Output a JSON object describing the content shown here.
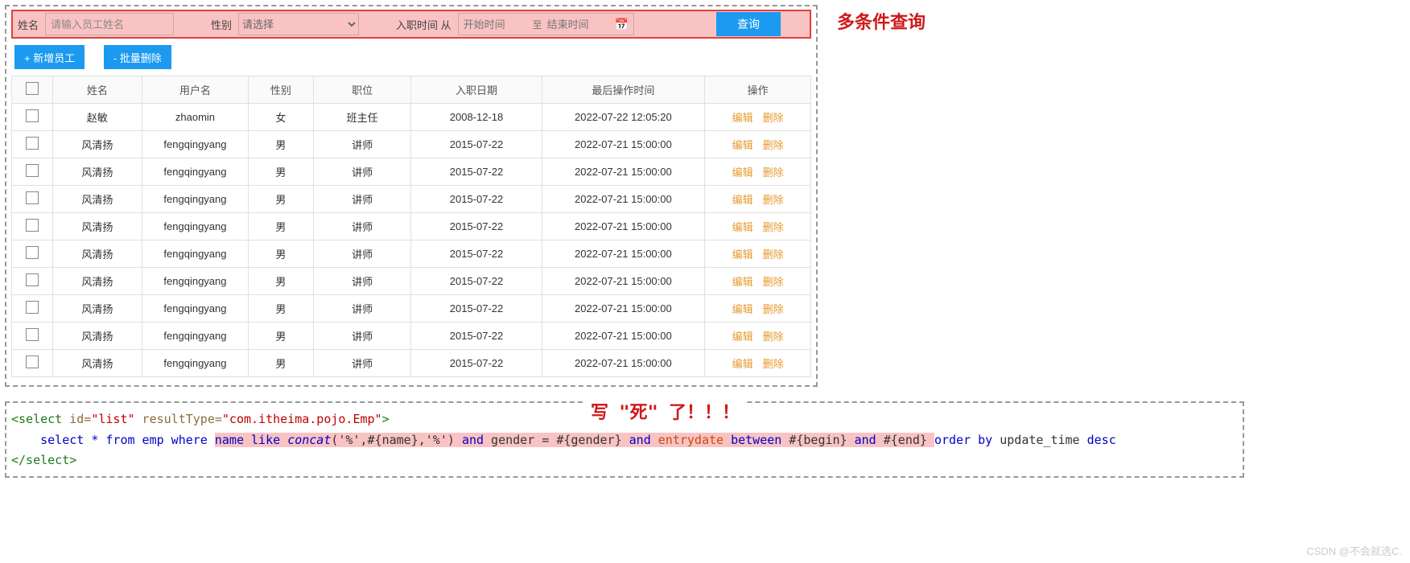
{
  "search": {
    "name_label": "姓名",
    "name_placeholder": "请输入员工姓名",
    "gender_label": "性别",
    "gender_placeholder": "请选择",
    "entry_label": "入职时间 从",
    "date_start_placeholder": "开始时间",
    "date_sep": "至",
    "date_end_placeholder": "结束时间",
    "query_btn": "查询"
  },
  "annotations": {
    "multi_condition": "多条件查询",
    "hardcoded": "写 \"死\" 了！！！"
  },
  "buttons": {
    "add_emp": "+ 新增员工",
    "batch_delete": "- 批量删除"
  },
  "table": {
    "headers": [
      "姓名",
      "用户名",
      "性别",
      "职位",
      "入职日期",
      "最后操作时间",
      "操作"
    ],
    "edit": "编辑",
    "delete": "删除",
    "rows": [
      {
        "name": "赵敏",
        "user": "zhaomin",
        "gender": "女",
        "pos": "班主任",
        "entry": "2008-12-18",
        "op": "2022-07-22 12:05:20"
      },
      {
        "name": "风清扬",
        "user": "fengqingyang",
        "gender": "男",
        "pos": "讲师",
        "entry": "2015-07-22",
        "op": "2022-07-21 15:00:00"
      },
      {
        "name": "风清扬",
        "user": "fengqingyang",
        "gender": "男",
        "pos": "讲师",
        "entry": "2015-07-22",
        "op": "2022-07-21 15:00:00"
      },
      {
        "name": "风清扬",
        "user": "fengqingyang",
        "gender": "男",
        "pos": "讲师",
        "entry": "2015-07-22",
        "op": "2022-07-21 15:00:00"
      },
      {
        "name": "风清扬",
        "user": "fengqingyang",
        "gender": "男",
        "pos": "讲师",
        "entry": "2015-07-22",
        "op": "2022-07-21 15:00:00"
      },
      {
        "name": "风清扬",
        "user": "fengqingyang",
        "gender": "男",
        "pos": "讲师",
        "entry": "2015-07-22",
        "op": "2022-07-21 15:00:00"
      },
      {
        "name": "风清扬",
        "user": "fengqingyang",
        "gender": "男",
        "pos": "讲师",
        "entry": "2015-07-22",
        "op": "2022-07-21 15:00:00"
      },
      {
        "name": "风清扬",
        "user": "fengqingyang",
        "gender": "男",
        "pos": "讲师",
        "entry": "2015-07-22",
        "op": "2022-07-21 15:00:00"
      },
      {
        "name": "风清扬",
        "user": "fengqingyang",
        "gender": "男",
        "pos": "讲师",
        "entry": "2015-07-22",
        "op": "2022-07-21 15:00:00"
      },
      {
        "name": "风清扬",
        "user": "fengqingyang",
        "gender": "男",
        "pos": "讲师",
        "entry": "2015-07-22",
        "op": "2022-07-21 15:00:00"
      }
    ]
  },
  "code": {
    "open_tag_pre": "<select ",
    "attr_id": "id=",
    "val_id": "\"list\"",
    "attr_rt": " resultType=",
    "val_rt": "\"com.itheima.pojo.Emp\"",
    "open_tag_post": ">",
    "indent": "    ",
    "sql_pre": "select * from emp where ",
    "hl_p1": "name like ",
    "hl_func": "concat",
    "hl_p2": "('%',#{name},'%') ",
    "hl_and1": "and",
    "hl_p3": " gender = #{gender} ",
    "hl_and2": "and",
    "hl_p4a": " ",
    "hl_col": "entrydate",
    "hl_p4b": " ",
    "hl_between": "between",
    "hl_p5": " #{begin} ",
    "hl_and3": "and",
    "hl_p6": " #{end} ",
    "sql_post_pre": "order by",
    "sql_post_col": " update_time ",
    "sql_post_desc": "desc",
    "close_tag": "</select>"
  },
  "watermark": "CSDN @不会就选C."
}
